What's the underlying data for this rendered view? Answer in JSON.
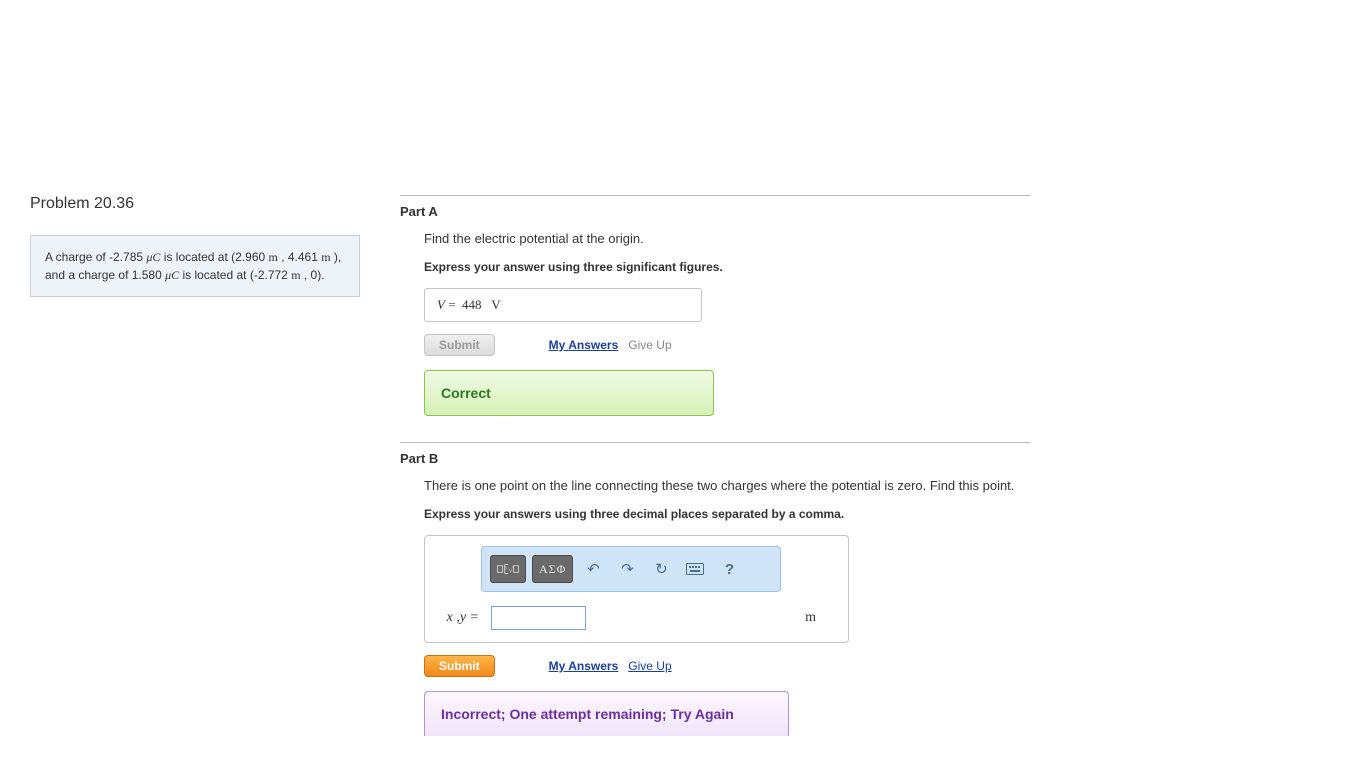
{
  "problem": {
    "title": "Problem 20.36",
    "statement_parts": {
      "p1": "A charge of -2.785 ",
      "u1": "μC",
      "p2": " is located at (2.960 ",
      "m1": "m",
      "p3": " , 4.461 ",
      "m2": "m",
      "p4": " ), and a charge of 1.580 ",
      "u2": "μC",
      "p5": " is located at (-2.772 ",
      "m3": "m",
      "p6": " , 0)."
    }
  },
  "partA": {
    "label": "Part A",
    "prompt": "Find the electric potential at the origin.",
    "instruction": "Express your answer using three significant figures.",
    "var": "V",
    "eq": " = ",
    "value": "448",
    "unit": "V",
    "submit": "Submit",
    "myanswers": "My Answers",
    "giveup": "Give Up",
    "feedback": "Correct"
  },
  "partB": {
    "label": "Part B",
    "prompt": "There is one point on the line connecting these two charges where the potential is zero. Find this point.",
    "instruction": "Express your answers using three decimal places separated by a comma.",
    "toolbar": {
      "greek": "ΑΣΦ",
      "undo": "↶",
      "redo": "↷",
      "reset": "↻",
      "keyboard": "⌨",
      "help": "?"
    },
    "lhs": "x ,y = ",
    "unit": "m",
    "submit": "Submit",
    "myanswers": "My Answers",
    "giveup": "Give Up",
    "feedback": "Incorrect; One attempt remaining; Try Again"
  }
}
